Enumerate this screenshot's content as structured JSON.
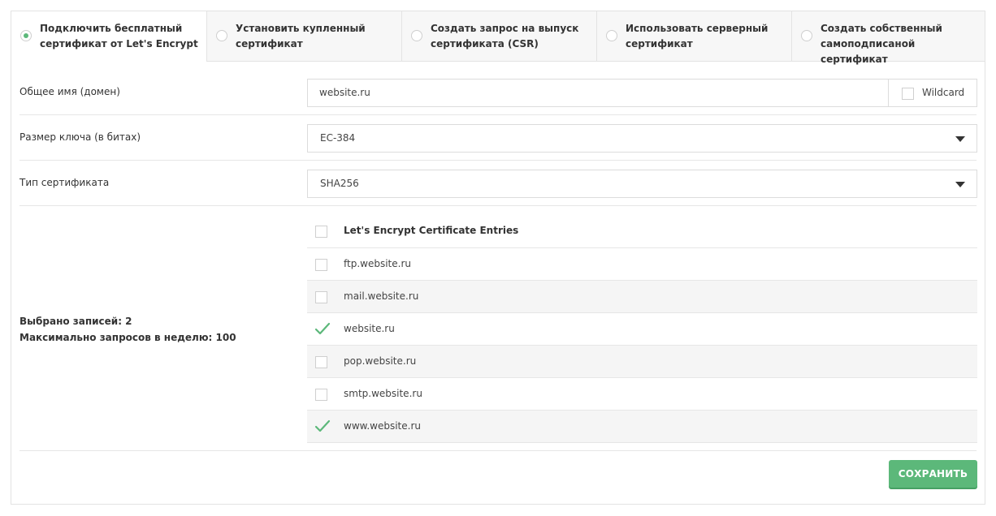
{
  "tabs": [
    {
      "label": "Подключить бесплатный сертификат от Let's Encrypt",
      "active": true
    },
    {
      "label": "Установить купленный сертификат",
      "active": false
    },
    {
      "label": "Создать запрос на выпуск сертификата (CSR)",
      "active": false
    },
    {
      "label": "Использовать серверный сертификат",
      "active": false
    },
    {
      "label": "Создать собственный самоподписаной сертификат",
      "active": false
    }
  ],
  "form": {
    "domain_label": "Общее имя (домен)",
    "domain_value": "website.ru",
    "wildcard_label": "Wildcard",
    "key_size_label": "Размер ключа (в битах)",
    "key_size_value": "EC-384",
    "cert_type_label": "Тип сертификата",
    "cert_type_value": "SHA256"
  },
  "entries": {
    "header": "Let's Encrypt Certificate Entries",
    "items": [
      {
        "label": "ftp.website.ru",
        "checked": false
      },
      {
        "label": "mail.website.ru",
        "checked": false
      },
      {
        "label": "website.ru",
        "checked": true
      },
      {
        "label": "pop.website.ru",
        "checked": false
      },
      {
        "label": "smtp.website.ru",
        "checked": false
      },
      {
        "label": "www.website.ru",
        "checked": true
      }
    ]
  },
  "summary": {
    "selected": "Выбрано записей: 2",
    "max_requests": "Максимально запросов в неделю: 100"
  },
  "actions": {
    "save_label": "СОХРАНИТЬ"
  },
  "colors": {
    "accent": "#5cb87a"
  }
}
